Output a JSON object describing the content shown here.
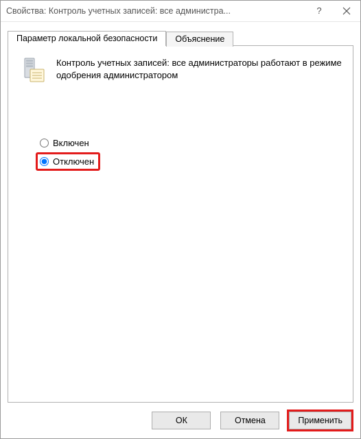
{
  "window": {
    "title": "Свойства: Контроль учетных записей: все администра..."
  },
  "tabs": {
    "active": "Параметр локальной безопасности",
    "inactive": "Объяснение"
  },
  "policy": {
    "description": "Контроль учетных записей: все администраторы работают в режиме одобрения администратором"
  },
  "radios": {
    "enabled": "Включен",
    "disabled": "Отключен"
  },
  "buttons": {
    "ok": "ОК",
    "cancel": "Отмена",
    "apply": "Применить"
  },
  "highlight": {
    "color": "#e31b1b"
  }
}
